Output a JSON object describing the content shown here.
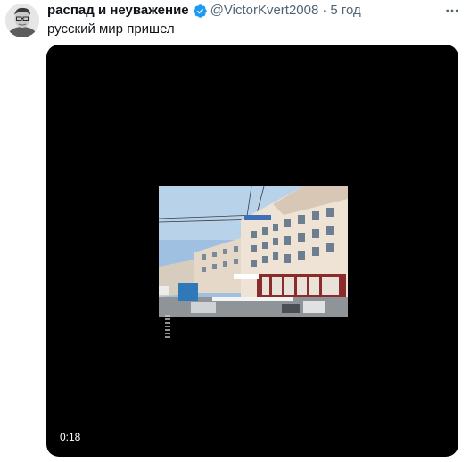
{
  "tweet": {
    "display_name": "распад и неуважение",
    "handle": "@VictorKvert2008",
    "separator": "·",
    "timestamp": "5 год",
    "text": "русский мир пришел",
    "verified": true,
    "avatar_icon": "user-avatar-photo",
    "more_icon": "more-options-icon"
  },
  "video": {
    "duration": "0:18",
    "thumbnail_icon": "street-building-frame"
  },
  "colors": {
    "name_text": "#0f1419",
    "secondary_text": "#536471",
    "verified_badge": "#1d9bf0",
    "video_background": "#000000"
  }
}
